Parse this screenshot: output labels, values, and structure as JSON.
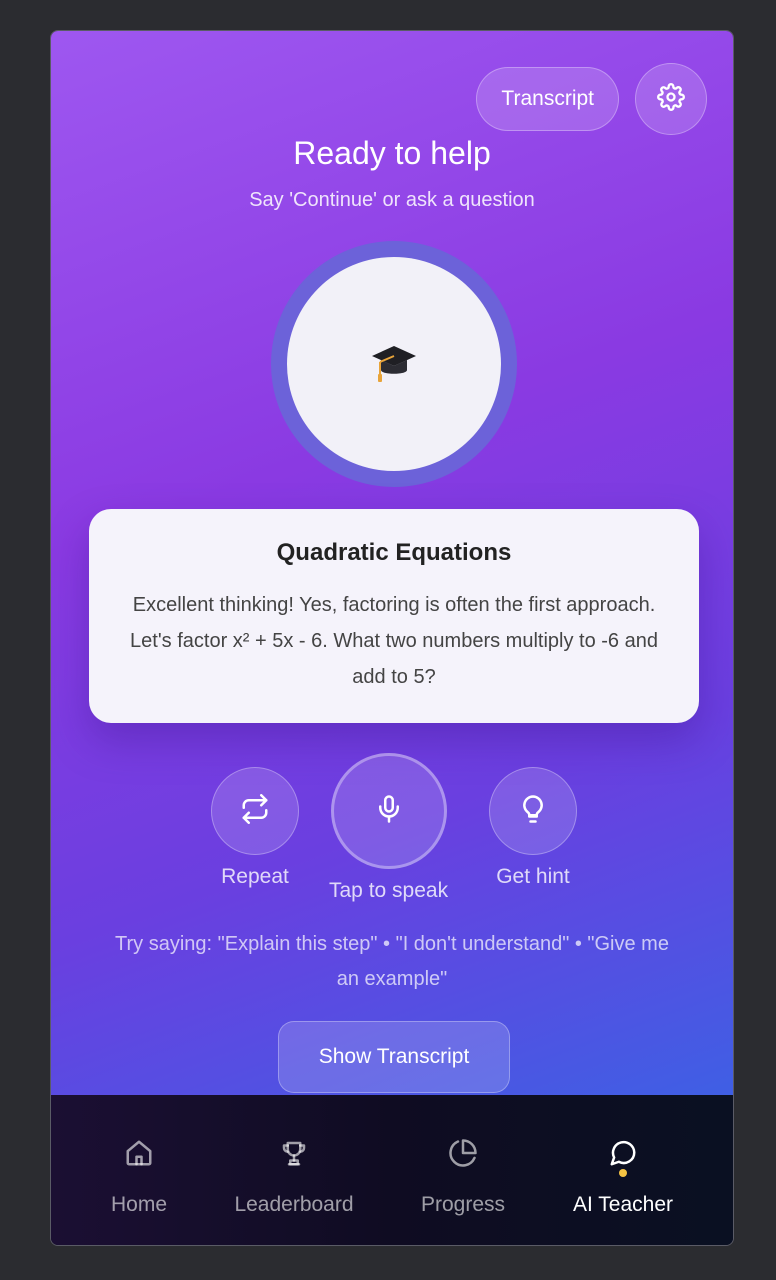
{
  "header": {
    "transcript_label": "Transcript",
    "settings_icon": "gear-icon"
  },
  "status": {
    "title": "Ready to help",
    "subtitle": "Say 'Continue' or ask a question"
  },
  "avatar": {
    "emoji": "🎓"
  },
  "card": {
    "title": "Quadratic Equations",
    "body": "Excellent thinking! Yes, factoring is often the first approach. Let's factor x² + 5x - 6. What two numbers multiply to -6 and add to 5?"
  },
  "controls": {
    "repeat": "Repeat",
    "speak": "Tap to speak",
    "hint": "Get hint"
  },
  "hints_text": "Try saying: \"Explain this step\" • \"I don't understand\" • \"Give me an example\"",
  "show_transcript_label": "Show Transcript",
  "nav": {
    "items": [
      {
        "label": "Home",
        "icon": "home-icon"
      },
      {
        "label": "Leaderboard",
        "icon": "trophy-icon"
      },
      {
        "label": "Progress",
        "icon": "pie-chart-icon"
      },
      {
        "label": "AI Teacher",
        "icon": "chat-bubble-icon"
      }
    ],
    "active": "AI Teacher"
  },
  "colors": {
    "gradient_start": "#9e57f0",
    "gradient_end": "#3f5fe4",
    "active_dot": "#f6c343"
  }
}
